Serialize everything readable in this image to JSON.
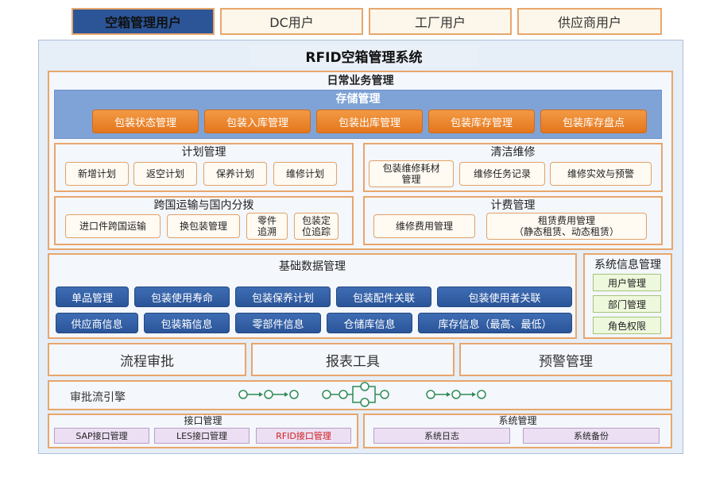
{
  "tabs": [
    "空箱管理用户",
    "DC用户",
    "工厂用户",
    "供应商用户"
  ],
  "system_title": "RFID空箱管理系统",
  "daily": {
    "title": "日常业务管理",
    "storage": {
      "title": "存储管理",
      "buttons": [
        "包装状态管理",
        "包装入库管理",
        "包装出库管理",
        "包装库存管理",
        "包装库存盘点"
      ]
    },
    "plan": {
      "title": "计划管理",
      "buttons": [
        "新增计划",
        "返空计划",
        "保养计划",
        "维修计划"
      ]
    },
    "clean": {
      "title": "清洁维修",
      "buttons": [
        "包装维修耗材\n管理",
        "维修任务记录",
        "维修实效与预警"
      ]
    },
    "transport": {
      "title": "跨国运输与国内分拨",
      "buttons": [
        "进口件跨国运输",
        "换包装管理",
        "零件\n追溯",
        "包装定\n位追踪"
      ]
    },
    "billing": {
      "title": "计费管理",
      "buttons": [
        "维修费用管理",
        "租赁费用管理\n（静态租赁、动态租赁）"
      ]
    }
  },
  "basic": {
    "title": "基础数据管理",
    "row1": [
      "单品管理",
      "包装使用寿命",
      "包装保养计划",
      "包装配件关联",
      "包装使用者关联"
    ],
    "row2": [
      "供应商信息",
      "包装箱信息",
      "零部件信息",
      "仓储库信息",
      "库存信息（最高、最低）"
    ]
  },
  "sysinfo": {
    "title": "系统信息管理",
    "buttons": [
      "用户管理",
      "部门管理",
      "角色权限"
    ]
  },
  "bottom_row": [
    "流程审批",
    "报表工具",
    "预警管理"
  ],
  "engine": {
    "label": "审批流引擎"
  },
  "interface": {
    "title": "接口管理",
    "buttons": [
      "SAP接口管理",
      "LES接口管理",
      "RFID接口管理"
    ]
  },
  "sysmgmt": {
    "title": "系统管理",
    "buttons": [
      "系统日志",
      "系统备份"
    ]
  }
}
